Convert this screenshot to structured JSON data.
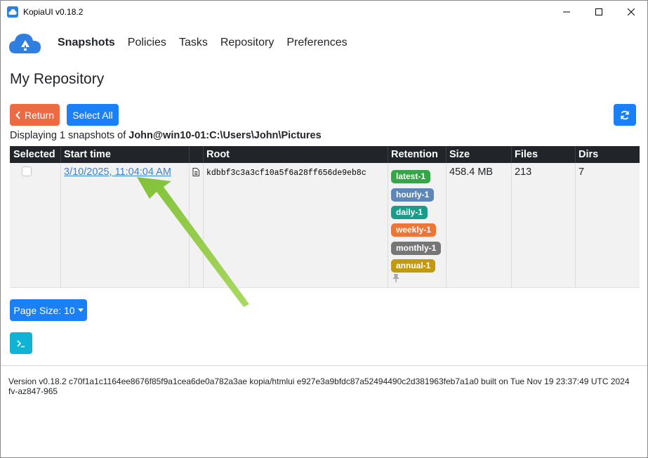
{
  "window": {
    "title": "KopiaUI v0.18.2"
  },
  "nav": {
    "items": [
      {
        "label": "Snapshots",
        "active": true
      },
      {
        "label": "Policies"
      },
      {
        "label": "Tasks"
      },
      {
        "label": "Repository"
      },
      {
        "label": "Preferences"
      }
    ]
  },
  "page": {
    "title": "My Repository"
  },
  "toolbar": {
    "return_label": "Return",
    "select_all_label": "Select All"
  },
  "summary": {
    "prefix": "Displaying 1 snapshots of ",
    "source": "John@win10-01:C:\\Users\\John\\Pictures"
  },
  "table": {
    "headers": [
      "Selected",
      "Start time",
      "",
      "Root",
      "Retention",
      "Size",
      "Files",
      "Dirs"
    ],
    "rows": [
      {
        "start_time": "3/10/2025, 11:04:04 AM",
        "root": "kdbbf3c3a3cf10a5f6a28ff656de9eb8c",
        "retention": [
          {
            "label": "latest-1",
            "color": "#36a54a"
          },
          {
            "label": "hourly-1",
            "color": "#5d87b8"
          },
          {
            "label": "daily-1",
            "color": "#1a9c8a"
          },
          {
            "label": "weekly-1",
            "color": "#ec7637"
          },
          {
            "label": "monthly-1",
            "color": "#767676"
          },
          {
            "label": "annual-1",
            "color": "#c49a0d"
          }
        ],
        "size": "458.4 MB",
        "files": "213",
        "dirs": "7"
      }
    ]
  },
  "pagination": {
    "page_size_label": "Page Size: 10"
  },
  "footer": {
    "version_text": "Version v0.18.2 c70f1a1c1164ee8676f85f9a1cea6de0a782a3ae kopia/htmlui e927e3a9bfdc87a52494490c2d381963feb7a1a0 built on Tue Nov 19 23:37:49 UTC 2024 fv-az847-965"
  },
  "colors": {
    "primary": "#1b7ff5",
    "return": "#ec6b44",
    "terminal": "#0fb3d4",
    "header_bg": "#212529",
    "annotation_arrow": "#8cc63f"
  }
}
